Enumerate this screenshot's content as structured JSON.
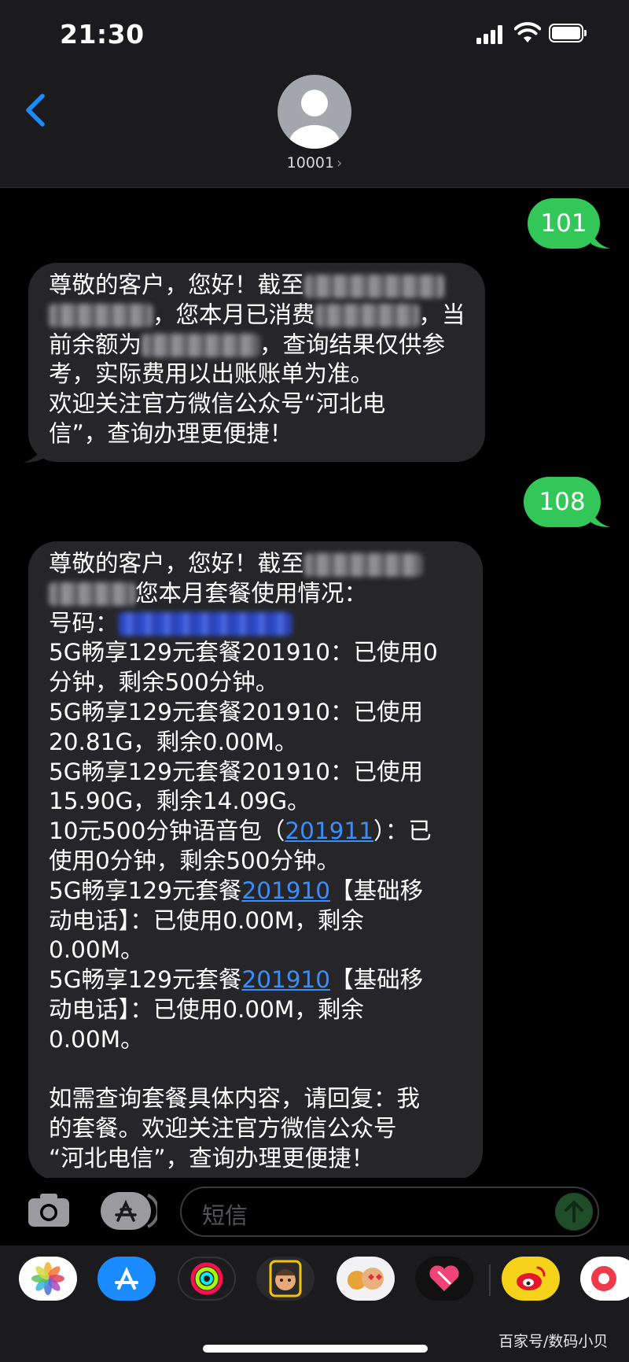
{
  "status_bar": {
    "time": "21:30"
  },
  "header": {
    "contact": "10001",
    "chevron": "›"
  },
  "messages": [
    {
      "type": "sent",
      "text": "101"
    },
    {
      "type": "received",
      "lines": [
        "尊敬的客户，您好！截至",
        "，您本月已消费",
        "，当",
        "前余额为",
        "，查询结果仅供参",
        "考，实际费用以出账账单为准。",
        "欢迎关注官方微信公众号“河北电",
        "信”，查询办理更便捷！"
      ]
    },
    {
      "type": "sent",
      "text": "108"
    },
    {
      "type": "received",
      "lines": [
        "尊敬的客户，您好！截至",
        "您本月套餐使用情况：",
        "号码：",
        "5G畅享129元套餐201910：已使用0",
        "分钟，剩余500分钟。",
        "5G畅享129元套餐201910：已使用",
        "20.81G，剩余0.00M。",
        "5G畅享129元套餐201910：已使用",
        "15.90G，剩余14.09G。",
        "10元500分钟语音包（",
        "201911",
        "）：已",
        "使用0分钟，剩余500分钟。",
        "5G畅享129元套餐",
        "201910",
        "【基础移",
        "动电话】：已使用0.00M，剩余",
        "0.00M。",
        "5G畅享129元套餐",
        "201910",
        "【基础移",
        "动电话】：已使用0.00M，剩余",
        "0.00M。",
        "如需查询套餐具体内容，请回复：我",
        "的套餐。欢迎关注官方微信公众号",
        "“河北电信”，查询办理更便捷！"
      ]
    }
  ],
  "input": {
    "placeholder": "短信"
  },
  "watermark": "百家号/数码小贝",
  "colors": {
    "sent_bubble": "#33c759",
    "received_bubble": "#262629",
    "link": "#3a8dfd",
    "accent": "#1a8cff"
  },
  "app_drawer": [
    "photos-icon",
    "app-store-icon",
    "activity-icon",
    "memoji-icon",
    "animoji-icon",
    "digital-touch-icon",
    "weibo-icon",
    "partial-app-icon"
  ]
}
